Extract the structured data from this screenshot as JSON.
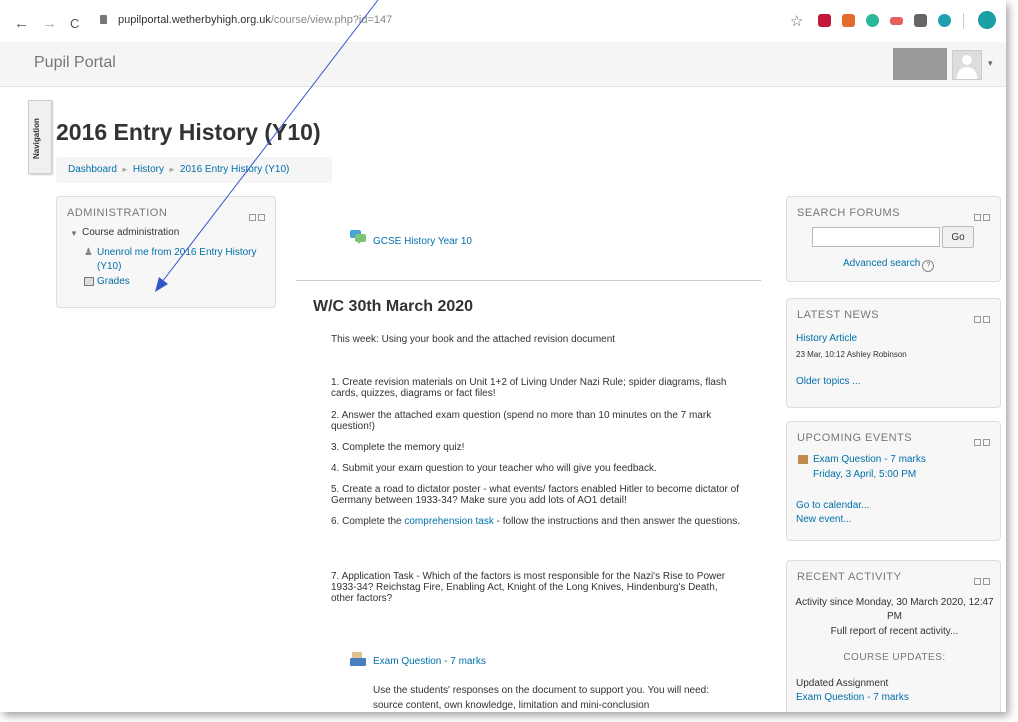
{
  "browser": {
    "back": "←",
    "forward": "→",
    "reload": "C",
    "url_host": "pupilportal.wetherbyhigh.org.uk",
    "url_path": "/course/view.php?id=147",
    "star": "☆"
  },
  "header": {
    "brand": "Pupil Portal",
    "caret": "▾"
  },
  "nav_tab": "Navigation",
  "page_title": "2016 Entry History (Y10)",
  "breadcrumb": {
    "items": [
      "Dashboard",
      "History",
      "2016 Entry History (Y10)"
    ],
    "separator": "►"
  },
  "admin": {
    "title": "ADMINISTRATION",
    "course_admin": "Course administration",
    "unenrol": "Unenrol me from 2016 Entry History (Y10)",
    "grades": "Grades"
  },
  "main": {
    "forum_link": "GCSE History Year 10",
    "section_title": "W/C 30th March 2020",
    "intro": "This week: Using your book and the attached revision document",
    "items": [
      "1. Create revision materials on Unit 1+2 of Living Under Nazi Rule; spider diagrams, flash cards, quizzes, diagrams or fact files!",
      "2. Answer the attached exam question (spend no more than 10 minutes on the 7 mark question!)",
      "3. Complete the memory quiz!",
      "4. Submit your exam question to your teacher who will give you feedback.",
      "5. Create a road to dictator poster - what events/ factors enabled Hitler to become dictator of Germany between 1933-34? Make sure you add lots of AO1 detail!"
    ],
    "item6_prefix": "6. Complete the ",
    "item6_link": "comprehension task",
    "item6_suffix": " - follow the instructions and then answer the questions.",
    "item7": "7. Application Task - Which of the factors is most responsible for the Nazi's Rise to Power 1933-34? Reichstag Fire, Enabling Act, Knight of the Long Knives, Hindenburg's Death, other factors?",
    "exam_link": "Exam Question - 7 marks",
    "exam_desc": "Use the students' responses on the document to support you. You will need: source content, own knowledge, limitation and mini-conclusion"
  },
  "search_forums": {
    "title": "SEARCH FORUMS",
    "go": "Go",
    "advanced": "Advanced search",
    "help": "?"
  },
  "latest_news": {
    "title": "LATEST NEWS",
    "article": "History Article",
    "meta": "23 Mar, 10:12  Ashley Robinson",
    "older": "Older topics ..."
  },
  "upcoming_events": {
    "title": "UPCOMING EVENTS",
    "event": "Exam Question - 7 marks",
    "event_date": "Friday, 3 April, 5:00 PM",
    "calendar": "Go to calendar...",
    "new_event": "New event..."
  },
  "recent_activity": {
    "title": "RECENT ACTIVITY",
    "since": "Activity since Monday, 30 March 2020, 12:47 PM",
    "full_report": "Full report of recent activity...",
    "course_updates": "COURSE UPDATES:",
    "updated": "Updated Assignment",
    "assignment": "Exam Question - 7 marks"
  },
  "colors": {
    "link": "#0070a8",
    "block_bg": "#f7f7f7",
    "arrow": "#3355cc"
  }
}
